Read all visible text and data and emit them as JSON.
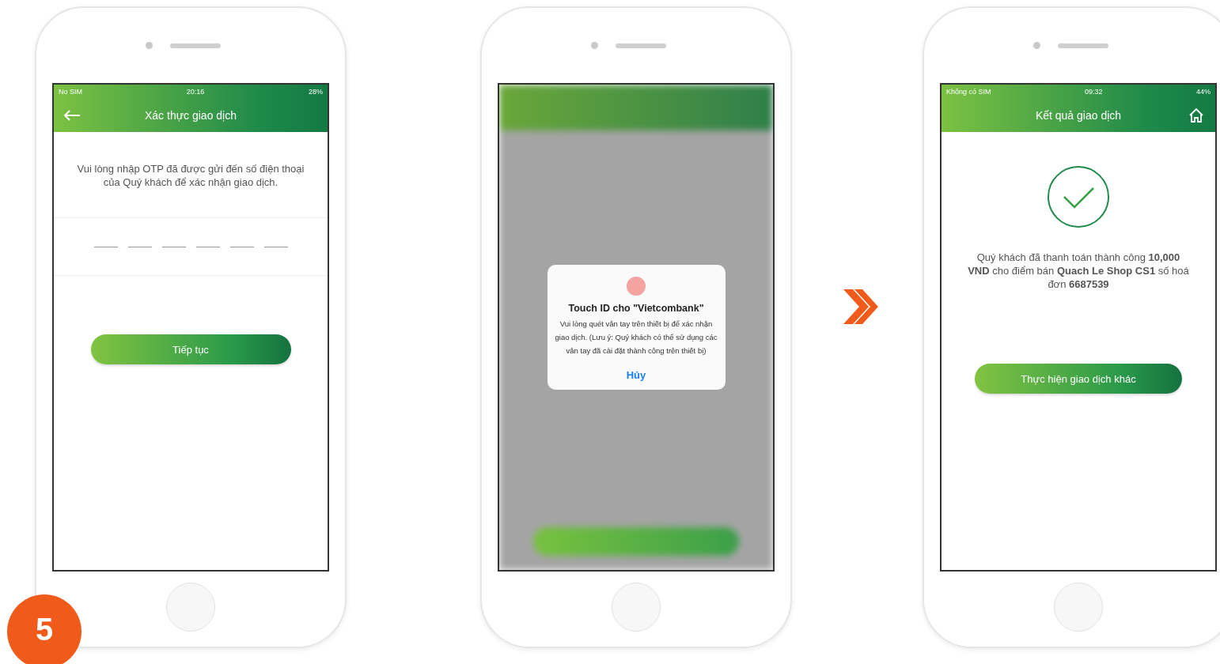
{
  "step_badge": "5",
  "phones": [
    {
      "kind": "otp",
      "status": {
        "carrier": "No SIM",
        "time": "20:16",
        "battery": "28%"
      },
      "title": "Xác thực giao dịch",
      "message": "Vui lòng nhập OTP đã được gửi đến số điện thoại của Quý khách để xác nhận giao dịch.",
      "button": "Tiếp tục"
    },
    {
      "kind": "touch_id",
      "dialog": {
        "title": "Touch ID cho \"Vietcombank\"",
        "message": "Vui lòng quét vân tay trên thiết bị để xác nhận giao dịch. (Lưu ý: Quý khách có thể sử dụng các vân tay đã cài đặt thành công trên thiết bị)",
        "cancel": "Hủy"
      }
    },
    {
      "kind": "result",
      "status": {
        "carrier": "Không có SIM",
        "time": "09:32",
        "battery": "44%"
      },
      "title": "Kết quả giao dịch",
      "message": "Quý khách đã thanh toán thành công **10,000 VND** cho điểm bán **Quach Le Shop CS1** số hoá đơn **6687539**",
      "button": "Thực hiện giao dịch khác"
    }
  ]
}
